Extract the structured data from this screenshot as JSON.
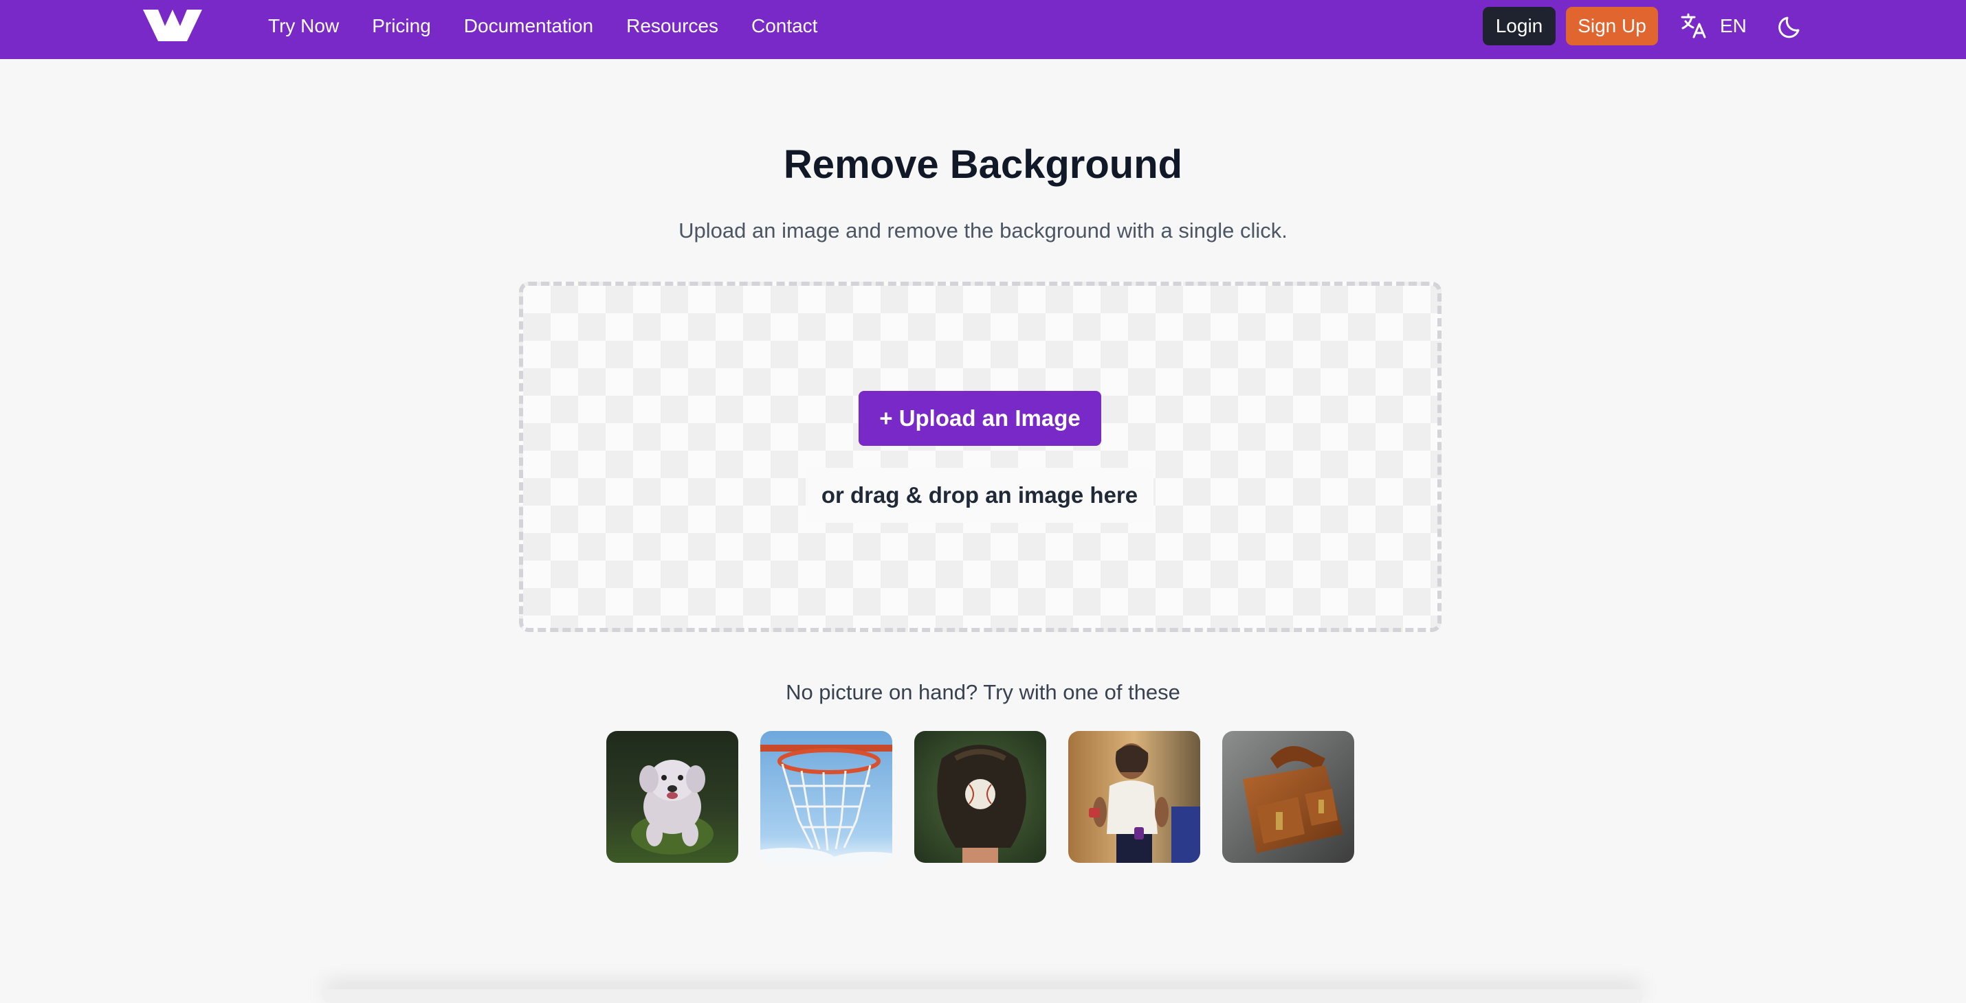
{
  "nav": {
    "links": [
      "Try Now",
      "Pricing",
      "Documentation",
      "Resources",
      "Contact"
    ],
    "login_label": "Login",
    "signup_label": "Sign Up",
    "language": "EN",
    "icons": {
      "logo": "brand-w-logo",
      "language": "translate-icon",
      "theme": "moon-icon"
    }
  },
  "main": {
    "title": "Remove Background",
    "subtitle": "Upload an image and remove the background with a single click.",
    "upload_label": "+ Upload an Image",
    "drop_hint": "or drag & drop an image here",
    "samples_label": "No picture on hand? Try with one of these",
    "samples": [
      "dog",
      "basketball hoop",
      "baseball glove",
      "runner",
      "leather bag"
    ]
  },
  "colors": {
    "brand": "#7829c8",
    "login_bg": "#1f2330",
    "signup_bg": "#e0652e",
    "background": "#f7f7f7"
  }
}
